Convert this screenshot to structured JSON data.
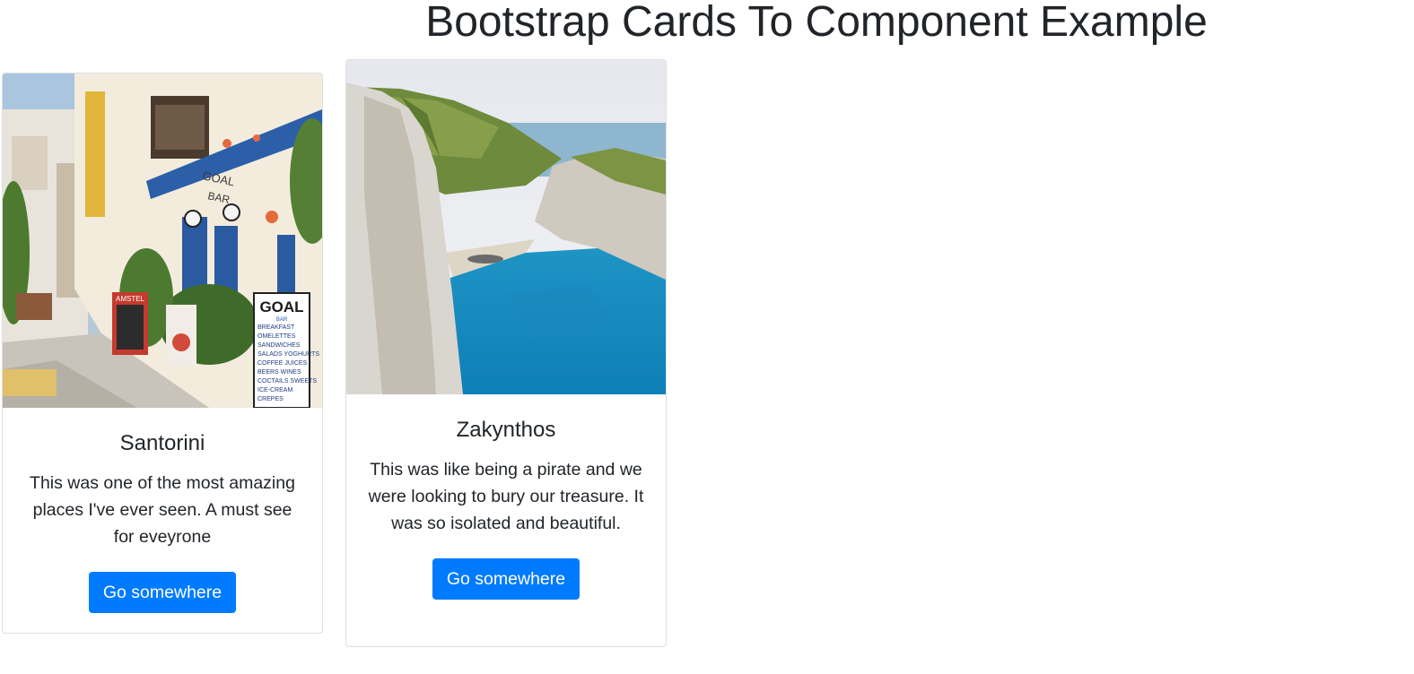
{
  "page": {
    "title": "Bootstrap Cards To Component Example"
  },
  "cards": [
    {
      "title": "Santorini",
      "text": "This was one of the most amazing places I've ever seen. A must see for eveyrone",
      "button_label": "Go somewhere",
      "image_desc": "street-with-goal-bar-photo"
    },
    {
      "title": "Zakynthos",
      "text": "This was like being a pirate and we were looking to bury our treasure. It was so isolated and beautiful.",
      "button_label": "Go somewhere",
      "image_desc": "cliff-beach-cove-photo"
    }
  ],
  "colors": {
    "primary": "#007bff",
    "text": "#212529",
    "border": "#dfdfdf"
  },
  "image_text": {
    "sign_goal": "GOAL",
    "sign_bar": "BAR",
    "sign_amstel": "AMSTEL",
    "menu_items": [
      "BREAKFAST",
      "OMELETTES",
      "SANDWICHES",
      "SALADS YOGHURTS",
      "COFFEE JUICES",
      "BEERS WINES",
      "COCTAILS SWEETS",
      "ICE-CREAM",
      "CREPES"
    ]
  }
}
